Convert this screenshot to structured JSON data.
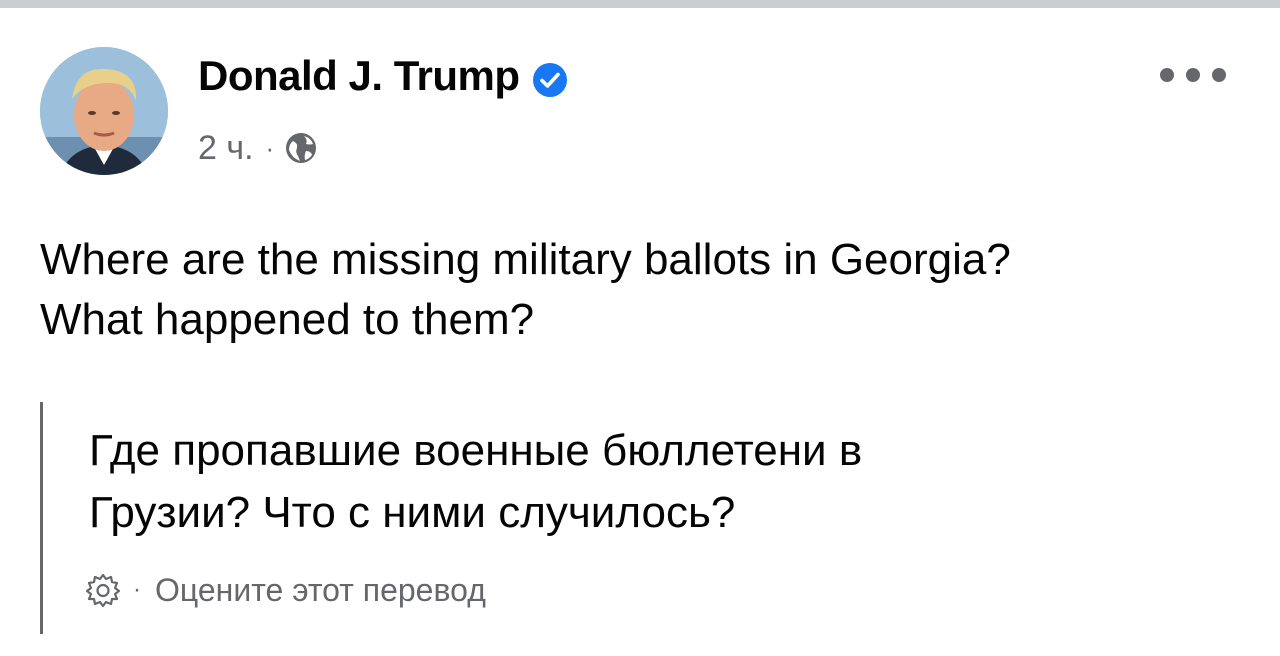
{
  "post": {
    "author_name": "Donald J. Trump",
    "timestamp": "2 ч.",
    "separator": "·",
    "audience_icon": "globe-icon",
    "more_icon": "more-horizontal-icon",
    "text_lines": [
      "Where are the missing military ballots in Georgia?",
      "What happened to them?"
    ]
  },
  "translation": {
    "text_lines": [
      "Где пропавшие военные бюллетени в",
      "Грузии? Что с ними случилось?"
    ],
    "settings_icon": "gear-icon",
    "separator": "·",
    "rate_label": "Оцените этот перевод"
  },
  "colors": {
    "verified_badge": "#1877f2",
    "secondary_text": "#65676b",
    "primary_text": "#050505"
  }
}
